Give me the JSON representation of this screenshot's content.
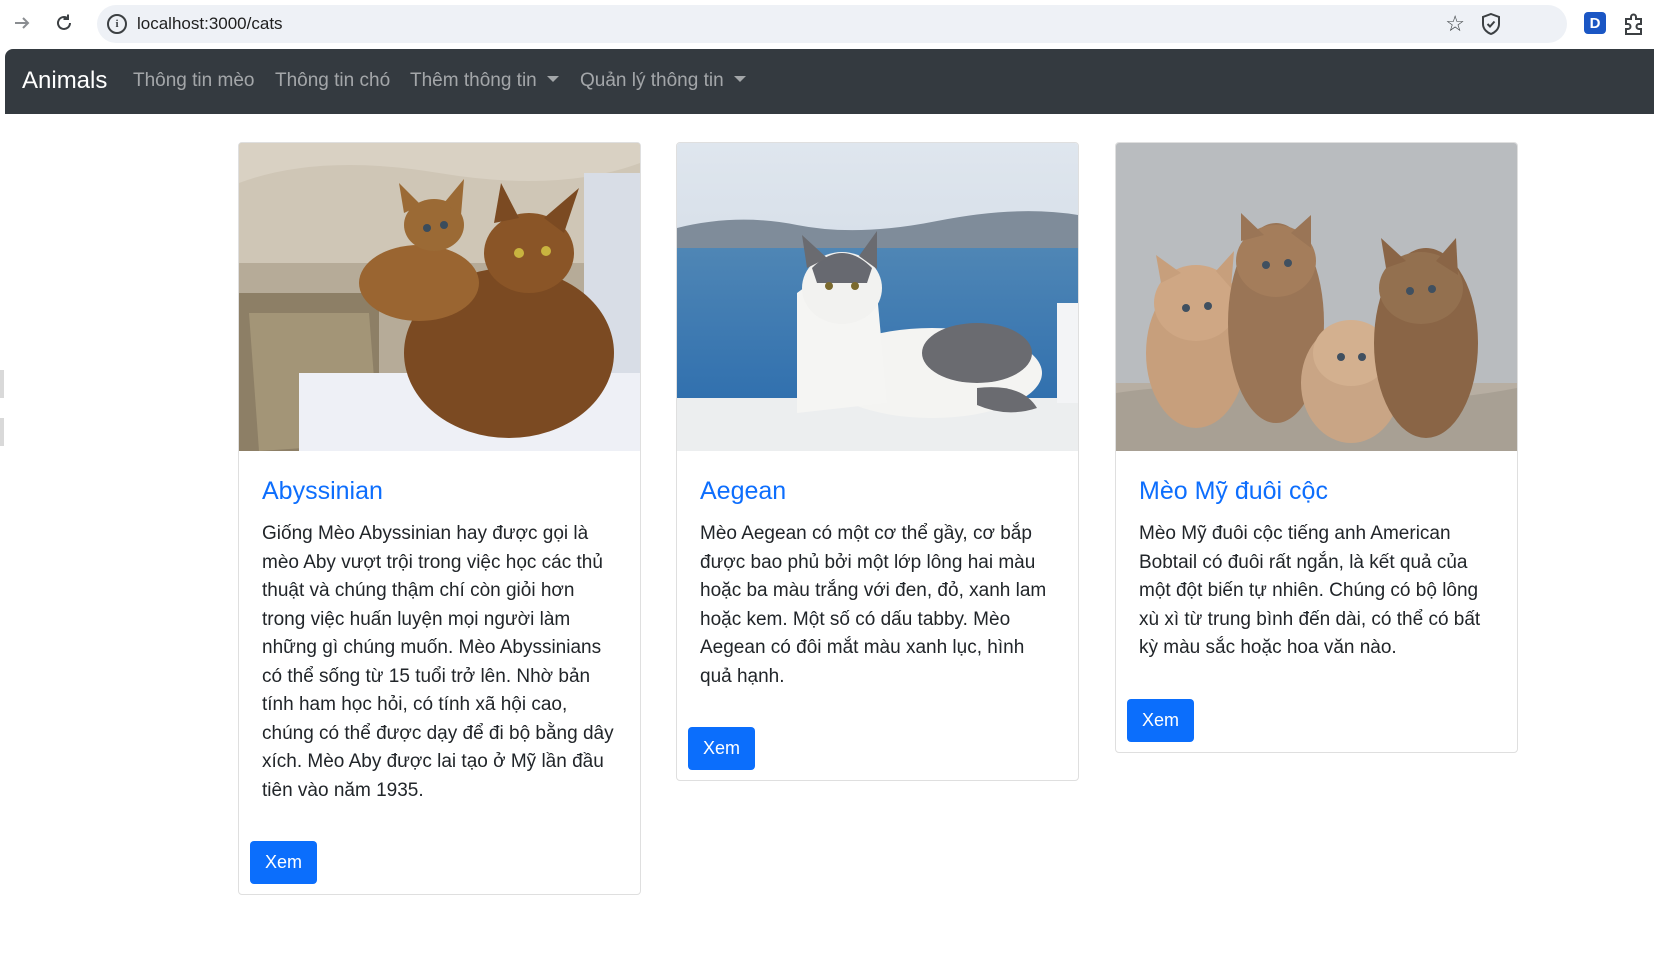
{
  "browser": {
    "url": "localhost:3000/cats",
    "extension_letter": "D"
  },
  "navbar": {
    "brand": "Animals",
    "links": [
      {
        "label": "Thông tin mèo",
        "dropdown": false
      },
      {
        "label": "Thông tin chó",
        "dropdown": false
      },
      {
        "label": "Thêm thông tin",
        "dropdown": true
      },
      {
        "label": "Quản lý thông tin",
        "dropdown": true
      }
    ]
  },
  "cards": [
    {
      "title": "Abyssinian",
      "text": "Giống Mèo Abyssinian hay được gọi là mèo Aby vượt trội trong việc học các thủ thuật và chúng thậm chí còn giỏi hơn trong việc huấn luyện mọi người làm những gì chúng muốn. Mèo Abyssinians có thể sống từ 15 tuổi trở lên. Nhờ bản tính ham học hỏi, có tính xã hội cao, chúng có thể được dạy để đi bộ bằng dây xích. Mèo Aby được lai tạo ở Mỹ lần đầu tiên vào năm 1935.",
      "button": "Xem"
    },
    {
      "title": "Aegean",
      "text": "Mèo Aegean có một cơ thể gầy, cơ bắp được bao phủ bởi một lớp lông hai màu hoặc ba màu trắng với đen, đỏ, xanh lam hoặc kem. Một số có dấu tabby. Mèo Aegean có đôi mắt màu xanh lục, hình quả hạnh.",
      "button": "Xem"
    },
    {
      "title": "Mèo Mỹ đuôi cộc",
      "text": "Mèo Mỹ đuôi cộc tiếng anh American Bobtail có đuôi rất ngắn, là kết quả của một đột biến tự nhiên. Chúng có bộ lông xù xì từ trung bình đến dài, có thể có bất kỳ màu sắc hoặc hoa văn nào.",
      "button": "Xem"
    }
  ]
}
